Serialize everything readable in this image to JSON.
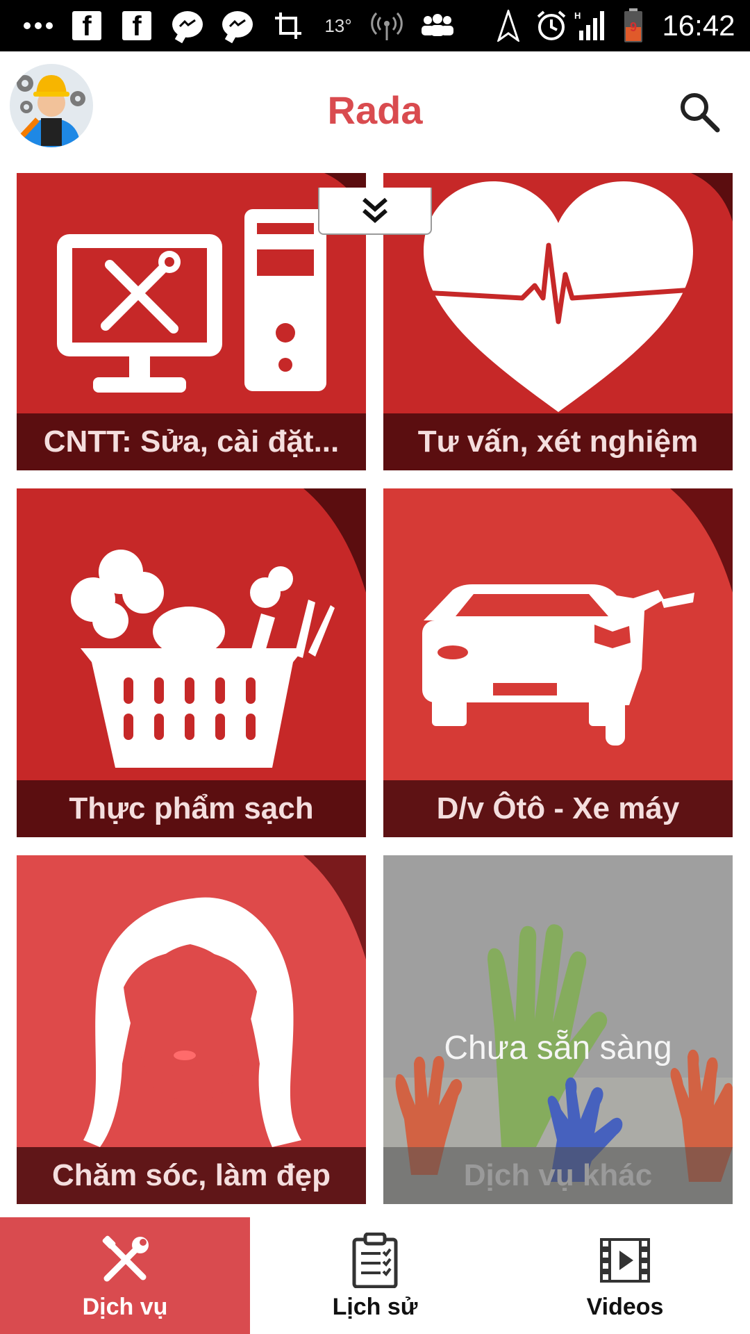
{
  "status_bar": {
    "temperature": "13°",
    "battery_level": "9",
    "time": "16:42",
    "icons": [
      "more-icon",
      "facebook-icon",
      "facebook-icon",
      "messenger-icon",
      "messenger-icon",
      "crop-icon",
      "temperature",
      "hotspot-icon",
      "group-icon",
      "navigation-icon",
      "alarm-icon",
      "signal-icon",
      "battery-icon"
    ]
  },
  "app_bar": {
    "title": "Rada",
    "avatar": "worker-avatar",
    "search_icon": "search-icon"
  },
  "categories": [
    {
      "label": "CNTT: Sửa, cài đặt...",
      "icon": "computer-repair-icon",
      "color": "#c62828"
    },
    {
      "label": "Tư vấn, xét nghiệm",
      "icon": "heart-pulse-icon",
      "color": "#c62828"
    },
    {
      "label": "Thực phẩm sạch",
      "icon": "vegetable-basket-icon",
      "color": "#c62828"
    },
    {
      "label": "D/v Ôtô - Xe máy",
      "icon": "car-motorbike-icon",
      "color": "#d63a36"
    },
    {
      "label": "Chăm sóc, làm đẹp",
      "icon": "woman-face-icon",
      "color": "#de4a4a"
    },
    {
      "label": "Dịch vụ khác",
      "icon": "painted-hands-image",
      "overlay": "Chưa sẵn sàng",
      "color": "#8c8c8c"
    }
  ],
  "collapse_handle_icon": "double-chevron-down-icon",
  "bottom_nav": [
    {
      "label": "Dịch vụ",
      "icon": "tools-icon",
      "active": true
    },
    {
      "label": "Lịch sử",
      "icon": "clipboard-icon",
      "active": false
    },
    {
      "label": "Videos",
      "icon": "film-icon",
      "active": false
    }
  ],
  "colors": {
    "accent": "#d94b4f",
    "tile_red": "#c62828"
  }
}
